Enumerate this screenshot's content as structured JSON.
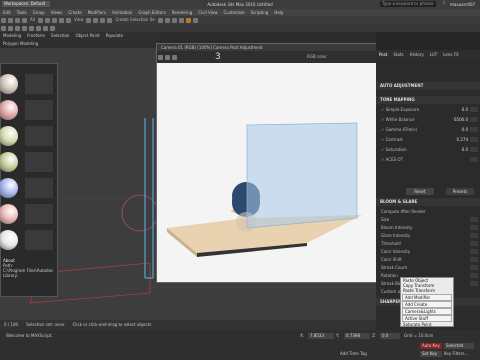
{
  "titlebar": {
    "workspace": "Workspaces: Default",
    "title": "Autodesk 3ds Max 2016    Untitled",
    "search_placeholder": "Type a keyword or phrase",
    "user": "maxuser007"
  },
  "menubar": {
    "items": [
      "Edit",
      "Tools",
      "Group",
      "Views",
      "Create",
      "Modifiers",
      "Animation",
      "Graph Editors",
      "Rendering",
      "Civil View",
      "Customize",
      "Scripting",
      "Help"
    ]
  },
  "toolbar": {
    "filter": "All",
    "view_select": "View",
    "selection_set": "Create Selection Se"
  },
  "ribbon": {
    "tabs": [
      "Modeling",
      "Freeform",
      "Selection",
      "Object Paint",
      "Populate"
    ],
    "secondary": [
      "Polygon Modeling"
    ]
  },
  "material_browser": {
    "about_title": "About",
    "about_lines": [
      "Path:",
      "C:\\Program Files\\Autodesk\\3ds Max",
      "Library:"
    ],
    "swatch_colors": [
      "#cfc6b8",
      "#e3a8a8",
      "#d8dcb0",
      "#c4cf9a",
      "#a8b8f0",
      "#f0b8b8",
      "#e8e8e8"
    ]
  },
  "framebuffer": {
    "title": "Camera 01 (RGB)  [100%]  Camera Post Adjustment",
    "zoom": "3",
    "channel": "RGB color"
  },
  "vfb_panel": {
    "tabs": [
      "Post",
      "Stats",
      "History",
      "LUT",
      "Lens FX"
    ],
    "auto_adjustment": "AUTO ADJUSTMENT",
    "tone_mapping": "TONE MAPPING",
    "tone_rows": [
      {
        "label": "Simple Exposure",
        "value": "0.0",
        "checked": true
      },
      {
        "label": "White Balance",
        "value": "6500.0",
        "checked": true
      },
      {
        "label": "Gamma (Filmic)",
        "value": "0.0",
        "checked": true
      },
      {
        "label": "Contrast",
        "value": "0.274",
        "checked": true
      },
      {
        "label": "Saturation",
        "value": "0.0",
        "checked": true
      },
      {
        "label": "ACES OT",
        "value": "",
        "checked": true
      }
    ],
    "reset_label": "Reset",
    "presets_label": "Presets",
    "bloom_glare": "BLOOM & GLARE",
    "bloom_rows": [
      "Compute After Render",
      "Size",
      "Bloom Intensity",
      "Glare Intensity",
      "Threshold",
      "Color Intensity",
      "Color Shift",
      "Streak Count",
      "Rotation",
      "Streak Blur",
      "Custom aperture"
    ],
    "sharpening": "SHARPENING & BLURRING"
  },
  "context_menu": {
    "items": [
      "Paste Object",
      "Copy Transform",
      "Paste Transform",
      "Add Modifier",
      "Add Create",
      "Camera&Lights",
      "Active Stuff",
      "Saturate Point"
    ],
    "highlighted": [
      3,
      4,
      5,
      6
    ]
  },
  "timeline": {
    "frame": "0 / 100",
    "status": "Selection set: none",
    "hint": "Click or click-and-drag to select objects"
  },
  "statusbar": {
    "x_label": "X:",
    "x_value": "7.8533",
    "y_label": "Y:",
    "y_value": "0.7398",
    "z_label": "Z:",
    "z_value": "0.0",
    "grid": "Grid = 10.0cm",
    "autokey": "Auto Key",
    "selected": "Selected",
    "setkey": "Set Key",
    "key_filters": "Key Filters...",
    "add_time_tag": "Add Time Tag",
    "script_prompt": "Welcome to MAXScript."
  },
  "colors": {
    "accent": "#2a72c8",
    "panel_bg": "#2b2b2b",
    "viewport_bg": "#3d3d3d",
    "floor": "#d8b888",
    "glass": "#a9c8ea",
    "sphere": "#2b4a6e"
  }
}
